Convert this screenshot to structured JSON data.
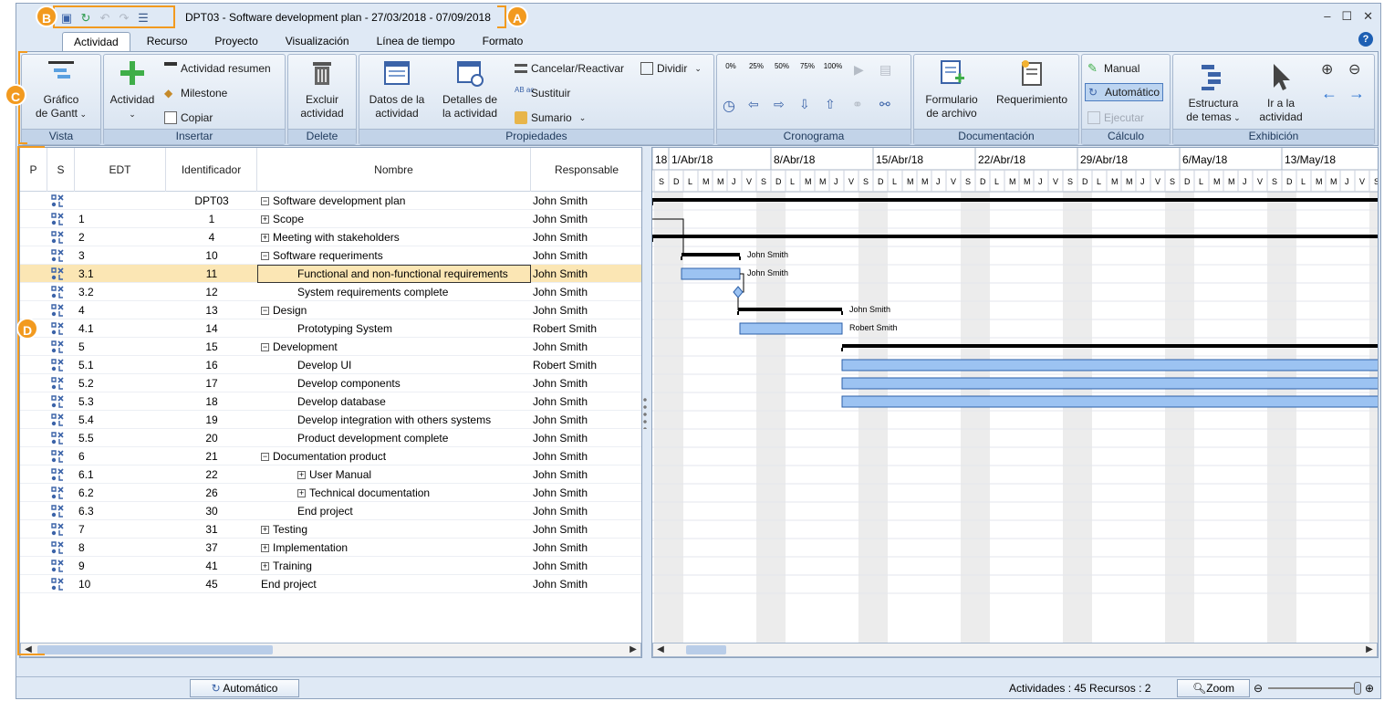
{
  "window": {
    "title": "DPT03 - Software development plan  -  27/03/2018 - 07/09/2018"
  },
  "callouts": {
    "a": "A",
    "b": "B",
    "c": "C",
    "d": "D"
  },
  "tabs": [
    "Actividad",
    "Recurso",
    "Proyecto",
    "Visualización",
    "Línea de tiempo",
    "Formato"
  ],
  "ribbon": {
    "vista": {
      "label": "Vista",
      "gantt": "Gráfico\nde Gantt"
    },
    "insertar": {
      "label": "Insertar",
      "actividad": "Actividad",
      "resumen": "Actividad resumen",
      "milestone": "Milestone",
      "copiar": "Copiar"
    },
    "delete": {
      "label": "Delete",
      "excluir": "Excluir\nactividad"
    },
    "propiedades": {
      "label": "Propiedades",
      "datos": "Datos de la\nactividad",
      "detalles": "Detalles de\nla actividad",
      "cancelar": "Cancelar/Reactivar",
      "sustituir": "Sustituir",
      "sumario": "Sumario",
      "dividir": "Dividir"
    },
    "cronograma": {
      "label": "Cronograma",
      "pcts": [
        "0%",
        "25%",
        "50%",
        "75%",
        "100%"
      ]
    },
    "documentacion": {
      "label": "Documentación",
      "formulario": "Formulario\nde archivo",
      "requerimiento": "Requerimiento"
    },
    "calculo": {
      "label": "Cálculo",
      "manual": "Manual",
      "automatico": "Automático",
      "ejecutar": "Ejecutar"
    },
    "exhibicion": {
      "label": "Exhibición",
      "estructura": "Estructura\nde temas",
      "ir": "Ir a la\nactividad"
    }
  },
  "grid": {
    "columns": [
      "P",
      "S",
      "EDT",
      "Identificador",
      "Nombre",
      "Responsable"
    ],
    "rows": [
      {
        "edt": "",
        "id": "DPT03",
        "name": "Software development plan",
        "resp": "John Smith",
        "level": 0,
        "exp": "minus"
      },
      {
        "edt": "1",
        "id": "1",
        "name": "Scope",
        "resp": "John Smith",
        "level": 0,
        "exp": "plus"
      },
      {
        "edt": "2",
        "id": "4",
        "name": "Meeting with stakeholders",
        "resp": "John Smith",
        "level": 0,
        "exp": "plus"
      },
      {
        "edt": "3",
        "id": "10",
        "name": "Software requeriments",
        "resp": "John Smith",
        "level": 0,
        "exp": "minus"
      },
      {
        "edt": "3.1",
        "id": "11",
        "name": "Functional and non-functional requirements",
        "resp": "John Smith",
        "level": 1,
        "exp": "",
        "sel": true
      },
      {
        "edt": "3.2",
        "id": "12",
        "name": "System requirements complete",
        "resp": "John Smith",
        "level": 1,
        "exp": ""
      },
      {
        "edt": "4",
        "id": "13",
        "name": "Design",
        "resp": "John Smith",
        "level": 0,
        "exp": "minus"
      },
      {
        "edt": "4.1",
        "id": "14",
        "name": "Prototyping System",
        "resp": "Robert Smith",
        "level": 1,
        "exp": ""
      },
      {
        "edt": "5",
        "id": "15",
        "name": "Development",
        "resp": "John Smith",
        "level": 0,
        "exp": "minus"
      },
      {
        "edt": "5.1",
        "id": "16",
        "name": "Develop UI",
        "resp": "Robert Smith",
        "level": 1,
        "exp": ""
      },
      {
        "edt": "5.2",
        "id": "17",
        "name": "Develop components",
        "resp": "John Smith",
        "level": 1,
        "exp": ""
      },
      {
        "edt": "5.3",
        "id": "18",
        "name": "Develop database",
        "resp": "John Smith",
        "level": 1,
        "exp": ""
      },
      {
        "edt": "5.4",
        "id": "19",
        "name": "Develop integration with others systems",
        "resp": "John Smith",
        "level": 1,
        "exp": ""
      },
      {
        "edt": "5.5",
        "id": "20",
        "name": "Product development complete",
        "resp": "John Smith",
        "level": 1,
        "exp": ""
      },
      {
        "edt": "6",
        "id": "21",
        "name": "Documentation product",
        "resp": "John Smith",
        "level": 0,
        "exp": "minus"
      },
      {
        "edt": "6.1",
        "id": "22",
        "name": "User Manual",
        "resp": "John Smith",
        "level": 1,
        "exp": "plus"
      },
      {
        "edt": "6.2",
        "id": "26",
        "name": "Technical documentation",
        "resp": "John Smith",
        "level": 1,
        "exp": "plus"
      },
      {
        "edt": "6.3",
        "id": "30",
        "name": "End project",
        "resp": "John Smith",
        "level": 1,
        "exp": ""
      },
      {
        "edt": "7",
        "id": "31",
        "name": "Testing",
        "resp": "John Smith",
        "level": 0,
        "exp": "plus"
      },
      {
        "edt": "8",
        "id": "37",
        "name": "Implementation",
        "resp": "John Smith",
        "level": 0,
        "exp": "plus"
      },
      {
        "edt": "9",
        "id": "41",
        "name": "Training",
        "resp": "John Smith",
        "level": 0,
        "exp": "plus"
      },
      {
        "edt": "10",
        "id": "45",
        "name": "End project",
        "resp": "John Smith",
        "level": 0,
        "exp": ""
      }
    ]
  },
  "gantt": {
    "weeks": [
      "18",
      "1/Abr/18",
      "8/Abr/18",
      "15/Abr/18",
      "22/Abr/18",
      "29/Abr/18",
      "6/May/18",
      "13/May/18"
    ],
    "days": [
      "S",
      "D",
      "L",
      "M",
      "M",
      "J",
      "V"
    ],
    "bar_labels": [
      {
        "row": 3,
        "text": "John Smith"
      },
      {
        "row": 4,
        "text": "John Smith"
      },
      {
        "row": 6,
        "text": "John Smith"
      },
      {
        "row": 7,
        "text": "Robert Smith"
      }
    ]
  },
  "status": {
    "mode": "Automático",
    "counts": "Actividades : 45  Recursos : 2",
    "zoom": "Zoom"
  }
}
